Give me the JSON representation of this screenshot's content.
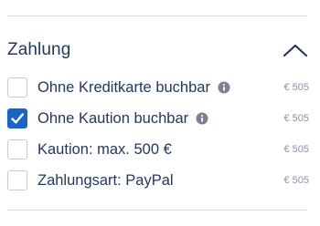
{
  "section": {
    "title": "Zahlung",
    "collapse_icon": "chevron-up-icon"
  },
  "options": [
    {
      "label": "Ohne Kreditkarte buchbar",
      "checked": false,
      "has_info": true,
      "price": "€ 505"
    },
    {
      "label": "Ohne Kaution buchbar",
      "checked": true,
      "has_info": true,
      "price": "€ 505"
    },
    {
      "label": "Kaution: max. 500 €",
      "checked": false,
      "has_info": false,
      "price": "€ 505"
    },
    {
      "label": "Zahlungsart: PayPal",
      "checked": false,
      "has_info": false,
      "price": "€ 505"
    }
  ],
  "colors": {
    "text": "#22385e",
    "accent": "#1b63c6",
    "price": "#8b93a1",
    "divider": "#d7dbe2"
  }
}
